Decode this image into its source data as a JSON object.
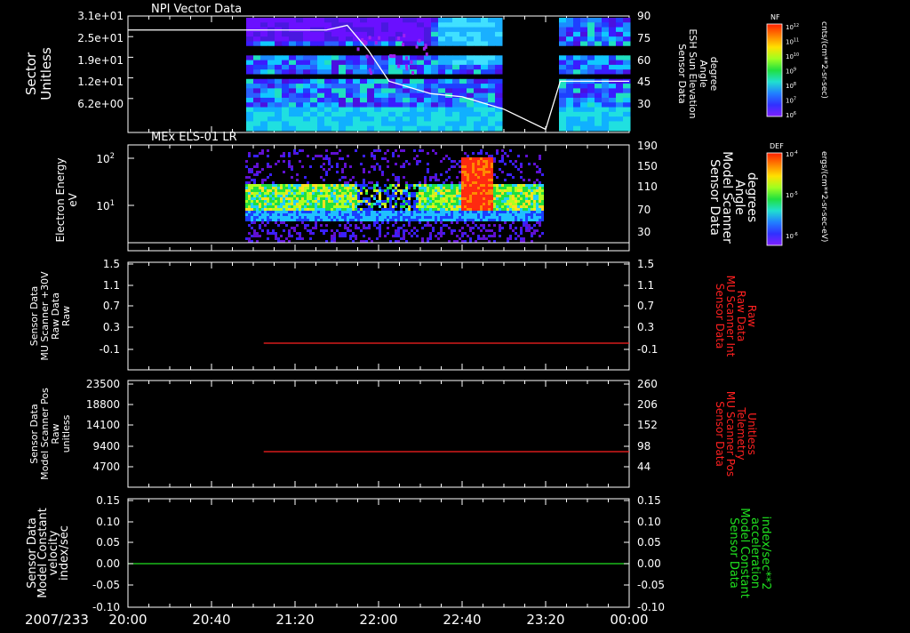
{
  "date_label": "2007/233",
  "time_ticks": [
    "20:00",
    "20:40",
    "21:20",
    "22:00",
    "22:40",
    "23:20",
    "00:00"
  ],
  "panels": [
    {
      "title": "NPI Vector Data",
      "left_label": [
        "Sector",
        "Unitless"
      ],
      "left_ticks": [
        "3.1e+01",
        "2.5e+01",
        "1.9e+01",
        "1.2e+01",
        "6.2e+00"
      ],
      "right_label": [
        "Sensor Data",
        "ESH Sun Elevation",
        "Angle",
        "degree"
      ],
      "right_ticks": [
        "90",
        "75",
        "60",
        "45",
        "30"
      ],
      "right_color": "#ffffff",
      "colorbar": {
        "name": "NF",
        "units": "cnts/(cm**2-sr-sec)",
        "ticks": [
          "10^12",
          "10^11",
          "10^10",
          "10^9",
          "10^8",
          "10^7",
          "10^6"
        ]
      }
    },
    {
      "title": "MEx ELS-01 LR",
      "left_label": [
        "Electron Energy",
        "eV"
      ],
      "left_ticks": [
        "10^2",
        "10^1"
      ],
      "right_label": [
        "Sensor Data",
        "Model Scanner",
        "Angle",
        "degrees"
      ],
      "right_ticks": [
        "190",
        "150",
        "110",
        "70",
        "30"
      ],
      "right_color": "#ffffff",
      "colorbar": {
        "name": "DEF",
        "units": "ergs/(cm**2-sr-sec-eV)",
        "ticks": [
          "10^-4",
          "10^-5",
          "10^-6"
        ]
      }
    },
    {
      "title": "",
      "left_label": [
        "Sensor Data",
        "MU Scanner +30V",
        "Raw Data",
        "Raw"
      ],
      "left_ticks": [
        "1.5",
        "1.1",
        "0.7",
        "0.3",
        "-0.1"
      ],
      "right_label": [
        "Sensor Data",
        "MU Scanner Int",
        "Raw Data",
        "Raw"
      ],
      "right_ticks": [
        "1.5",
        "1.1",
        "0.7",
        "0.3",
        "-0.1"
      ],
      "right_color": "#ff2020"
    },
    {
      "title": "",
      "left_label": [
        "Sensor Data",
        "Model Scanner Pos",
        "Raw",
        "unitless"
      ],
      "left_ticks": [
        "23500",
        "18800",
        "14100",
        "9400",
        "4700"
      ],
      "right_label": [
        "Sensor Data",
        "MU Scanner Pos",
        "Telemetry",
        "Unitless"
      ],
      "right_ticks": [
        "260",
        "206",
        "152",
        "98",
        "44"
      ],
      "right_color": "#ff2020"
    },
    {
      "title": "",
      "left_label": [
        "Sensor Data",
        "Model Constant",
        "velocity",
        "index/sec"
      ],
      "left_ticks": [
        "0.15",
        "0.10",
        "0.05",
        "0.00",
        "-0.05",
        "-0.10"
      ],
      "right_label": [
        "Sensor Data",
        "Model Constant",
        "acceleration",
        "index/sec**2"
      ],
      "right_ticks": [
        "0.15",
        "0.10",
        "0.05",
        "0.00",
        "-0.05",
        "-0.10"
      ],
      "right_color": "#20e020"
    }
  ],
  "chart_data": [
    {
      "type": "heatmap",
      "title": "NPI Vector Data",
      "x_range": [
        "20:00",
        "00:00"
      ],
      "data_start": "21:10",
      "gaps": [
        [
          "22:58",
          "23:23"
        ]
      ],
      "ylabel": "Sector (Unitless)",
      "ylim": [
        0,
        31
      ],
      "overlay_line": {
        "name": "ESH Sun Elevation Angle",
        "unit": "degree",
        "ylim": [
          15,
          90
        ],
        "x": [
          "20:00",
          "21:35",
          "21:45",
          "21:55",
          "22:05",
          "22:15",
          "22:25",
          "22:40",
          "23:00",
          "23:20",
          "23:27",
          "00:00"
        ],
        "y": [
          81,
          81,
          84,
          68,
          48,
          44,
          40,
          38,
          30,
          17,
          48,
          48
        ]
      }
    },
    {
      "type": "heatmap",
      "title": "MEx ELS-01 LR",
      "x_range": [
        "20:00",
        "00:00"
      ],
      "data_start": "21:10",
      "data_end": "23:10",
      "ylabel": "Electron Energy (eV)",
      "yscale": "log",
      "scanner_angle_line": {
        "ylim": [
          10,
          190
        ],
        "value": 12
      }
    },
    {
      "type": "line",
      "series": [
        {
          "name": "MU Scanner Int Raw Data",
          "x_start": "21:05",
          "x_end": "00:00",
          "value": -0.1
        }
      ],
      "ylim": [
        -0.3,
        1.5
      ]
    },
    {
      "type": "line",
      "series": [
        {
          "name": "MU Scanner Pos Telemetry",
          "x_start": "21:05",
          "x_end": "00:00",
          "value": 98
        }
      ],
      "ylim": [
        0,
        23500
      ]
    },
    {
      "type": "line",
      "series": [
        {
          "name": "Model Constant velocity",
          "x_start": "20:00",
          "x_end": "00:00",
          "value": 0.0
        }
      ],
      "ylim": [
        -0.1,
        0.15
      ]
    }
  ]
}
